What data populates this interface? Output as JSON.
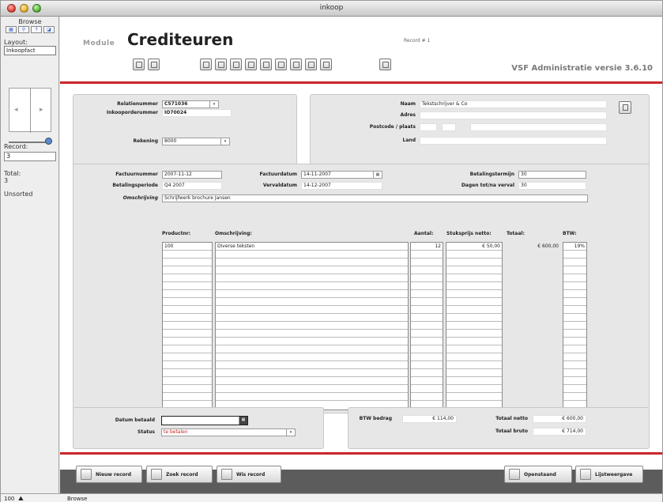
{
  "window": {
    "title": "inkoop"
  },
  "status_area": {
    "mode": "Browse",
    "layout_label": "Layout:",
    "layout_value": "Inkoopfact",
    "record_label": "Record:",
    "record_value": "3",
    "total_label": "Total:",
    "total_value": "3",
    "sort_state": "Unsorted",
    "zoom": "100",
    "mode_text": "Browse"
  },
  "header": {
    "module_word": "Module",
    "module_name": "Crediteuren",
    "record_no": "Record # 1",
    "version": "VSF Administratie versie 3.6.10"
  },
  "relation": {
    "relatienummer_label": "Relatienummer",
    "relatienummer": "C571036",
    "inkoopordernummer_label": "Inkooporderummer",
    "inkoopordernummer": "IO70024",
    "rekening_label": "Rekening",
    "rekening": "8000",
    "naam_label": "Naam",
    "naam": "Tekstschrijver & Co",
    "adres_label": "Adres",
    "postcode_label": "Postcode / plaats",
    "land_label": "Land"
  },
  "invoice": {
    "factuurnummer_label": "Factuurnummer",
    "factuurnummer": "2007-11-12",
    "factuurdatum_label": "Factuurdatum",
    "factuurdatum": "14-11-2007",
    "betalingstermijn_label": "Betalingstermijn",
    "betalingstermijn": "30",
    "betalingsperiode_label": "Betalingsperiode",
    "betalingsperiode": "Q4 2007",
    "vervaldatum_label": "Vervaldatum",
    "vervaldatum": "14-12-2007",
    "dagen_label": "Dagen tot/na verval",
    "dagen": "30",
    "omschrijving_label": "Omschrijving",
    "omschrijving": "Schrijfwerk brochure Jansen"
  },
  "lines": {
    "headers": {
      "productnr": "Productnr:",
      "omschrijving": "Omschrijving:",
      "aantal": "Aantal:",
      "stuksprijs": "Stuksprijs netto:",
      "totaal": "Totaal:",
      "btw": "BTW:"
    },
    "row1": {
      "productnr": "100",
      "omschrijving": "Diverse teksten",
      "aantal": "12",
      "stuksprijs": "€ 50,00",
      "totaal": "€ 600,00",
      "btw": "19%"
    }
  },
  "payment": {
    "datum_label": "Datum betaald",
    "datum": "",
    "status_label": "Status",
    "status": "te betalen",
    "btw_bedrag_label": "BTW bedrag",
    "btw_bedrag": "€ 114,00",
    "totaal_netto_label": "Totaal netto",
    "totaal_netto": "€ 600,00",
    "totaal_bruto_label": "Totaal bruto",
    "totaal_bruto": "€ 714,00"
  },
  "footer": {
    "nieuw": "Nieuw record",
    "zoek": "Zoek record",
    "wis": "Wis record",
    "openstaand": "Openstaand",
    "lijstweergave": "Lijstweergave"
  },
  "colors": {
    "accent_red": "#c9252b",
    "footer_bg": "#5c5c5c"
  }
}
